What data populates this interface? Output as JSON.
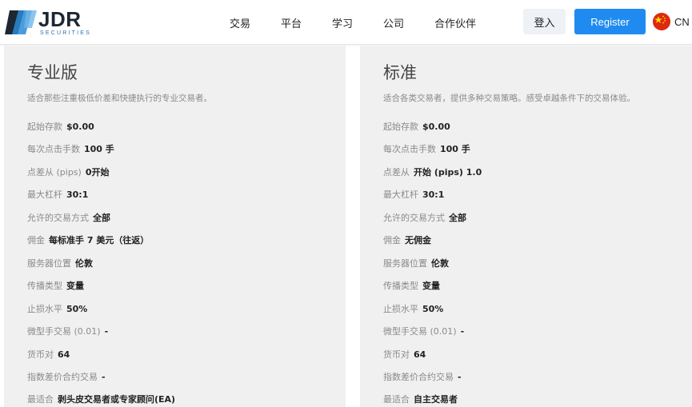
{
  "brand": {
    "name": "JDR",
    "sub": "SECURITIES",
    "colors": {
      "mark_dark": "#1d2733",
      "mark_blue": "#2a8bd6",
      "accent": "#1f8bf0"
    }
  },
  "nav": {
    "items": [
      {
        "label": "交易"
      },
      {
        "label": "平台"
      },
      {
        "label": "学习"
      },
      {
        "label": "公司"
      },
      {
        "label": "合作伙伴"
      }
    ]
  },
  "auth": {
    "login_label": "登入",
    "register_label": "Register"
  },
  "language": {
    "code": "CN",
    "flag_icon": "china-flag-icon"
  },
  "plans": [
    {
      "title": "专业版",
      "description": "适合那些注重极低价差和快捷执行的专业交易者。",
      "specs": [
        {
          "label": "起始存款",
          "value": "$0.00"
        },
        {
          "label": "每次点击手数",
          "value": "100 手"
        },
        {
          "label": "点差从 (pips)",
          "value": "0开始"
        },
        {
          "label": "最大杠杆",
          "value": "30:1"
        },
        {
          "label": "允许的交易方式",
          "value": "全部"
        },
        {
          "label": "佣金",
          "value": "每标准手 7 美元（往返）"
        },
        {
          "label": "服务器位置",
          "value": "伦敦"
        },
        {
          "label": "传播类型",
          "value": "变量"
        },
        {
          "label": "止损水平",
          "value": "50%"
        },
        {
          "label": "微型手交易 (0.01)",
          "value": "-"
        },
        {
          "label": "货币对",
          "value": "64"
        },
        {
          "label": "指数差价合约交易",
          "value": "-"
        },
        {
          "label": "最适合",
          "value": "剥头皮交易者或专家顾问(EA)"
        }
      ]
    },
    {
      "title": "标准",
      "description": "适合各类交易者，提供多种交易策略。感受卓越条件下的交易体验。",
      "specs": [
        {
          "label": "起始存款",
          "value": "$0.00"
        },
        {
          "label": "每次点击手数",
          "value": "100 手"
        },
        {
          "label": "点差从",
          "value": "开始 (pips) 1.0"
        },
        {
          "label": "最大杠杆",
          "value": "30:1"
        },
        {
          "label": "允许的交易方式",
          "value": "全部"
        },
        {
          "label": "佣金",
          "value": "无佣金"
        },
        {
          "label": "服务器位置",
          "value": "伦敦"
        },
        {
          "label": "传播类型",
          "value": "变量"
        },
        {
          "label": "止损水平",
          "value": "50%"
        },
        {
          "label": "微型手交易 (0.01)",
          "value": "-"
        },
        {
          "label": "货币对",
          "value": "64"
        },
        {
          "label": "指数差价合约交易",
          "value": "-"
        },
        {
          "label": "最适合",
          "value": "自主交易者"
        }
      ]
    }
  ]
}
